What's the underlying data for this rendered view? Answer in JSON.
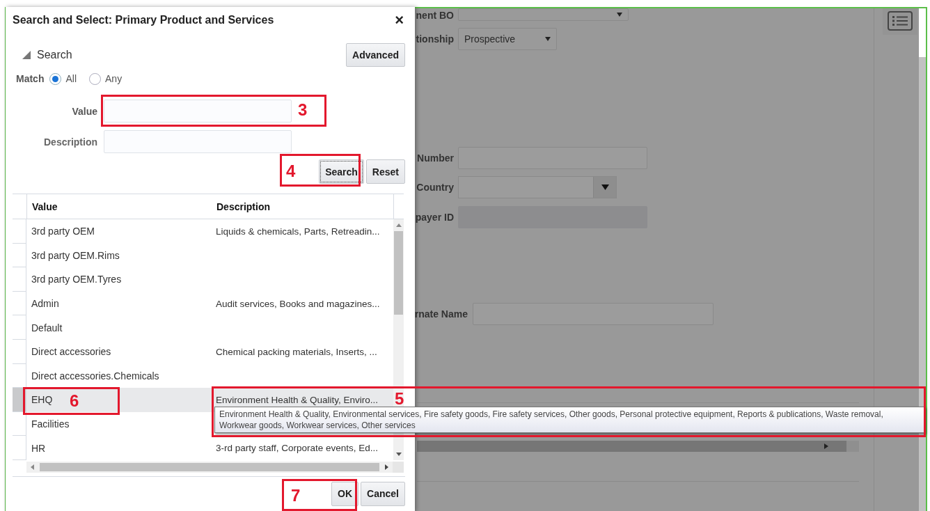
{
  "background_form": {
    "fields": [
      {
        "label": "nent BO",
        "kind": "select"
      },
      {
        "label": "tionship",
        "kind": "select",
        "value": "Prospective"
      },
      {
        "label": "Number",
        "kind": "text"
      },
      {
        "label": "Country",
        "kind": "combo"
      },
      {
        "label": "payer ID",
        "kind": "disabled"
      },
      {
        "label": "rnate Name",
        "kind": "text"
      }
    ]
  },
  "dialog": {
    "title": "Search and Select: Primary Product and Services",
    "close": "×",
    "search_header": "Search",
    "advanced_button": "Advanced",
    "match": {
      "label": "Match",
      "options": [
        {
          "label": "All",
          "selected": true
        },
        {
          "label": "Any",
          "selected": false
        }
      ]
    },
    "fields": [
      {
        "label": "Value"
      },
      {
        "label": "Description"
      }
    ],
    "search_button": {
      "label": "Search",
      "focused": true
    },
    "reset_button": "Reset",
    "table": {
      "columns": [
        "Value",
        "Description"
      ],
      "rows": [
        {
          "value": "3rd party OEM",
          "description": "Liquids & chemicals, Parts, Retreadin...",
          "selected": false
        },
        {
          "value": "3rd party OEM.Rims",
          "selected": false
        },
        {
          "value": "3rd party OEM.Tyres",
          "selected": false
        },
        {
          "value": "Admin",
          "description": "Audit services, Books and magazines...",
          "selected": false
        },
        {
          "value": "Default",
          "selected": false
        },
        {
          "value": "Direct accessories",
          "description": "Chemical packing materials, Inserts, ...",
          "selected": false
        },
        {
          "value": "Direct accessories.Chemicals",
          "selected": false
        },
        {
          "value": "EHQ",
          "description": "Environment Health & Quality, Enviro...",
          "selected": true
        },
        {
          "value": "Facilities",
          "selected": false
        },
        {
          "value": "HR",
          "description": "3-rd party staff, Corporate events, Ed...",
          "selected": false
        }
      ]
    },
    "footer_buttons": [
      "OK",
      "Cancel"
    ]
  },
  "tooltip": {
    "lines": [
      "Environment Health & Quality, Environmental services, Fire safety goods, Fire safety services, Other goods, Personal protective equipment, Reports & publications, Waste removal,",
      "Workwear goods, Workwear services, Other services"
    ]
  },
  "annotations": [
    {
      "label": "3"
    },
    {
      "label": "4"
    },
    {
      "label": "5"
    },
    {
      "label": "6"
    },
    {
      "label": "7"
    }
  ]
}
